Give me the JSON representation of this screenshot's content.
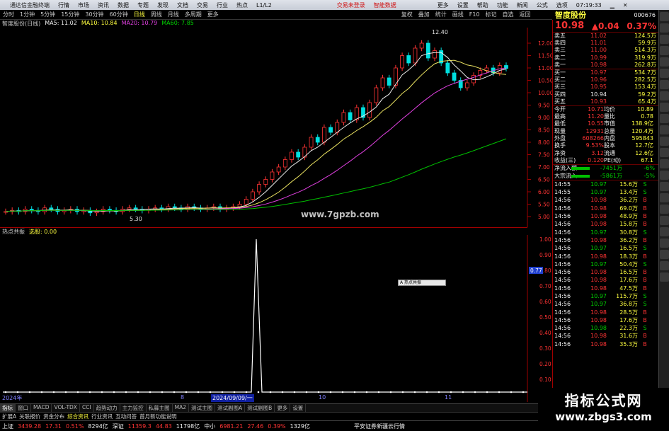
{
  "titlebar": {
    "app": "通达信金融终端",
    "menus": [
      "行情",
      "市场",
      "资讯",
      "数据",
      "专题",
      "发现",
      "文档",
      "交易",
      "行业",
      "热点",
      "L1/L2"
    ],
    "center_links": [
      "交易未登录",
      "智能数据"
    ],
    "right_menus": [
      "更多",
      "设置",
      "帮助",
      "功能",
      "新闻",
      "公式",
      "选项"
    ],
    "time": "07:19:33"
  },
  "toolbar": {
    "periods": [
      "分时",
      "1分钟",
      "5分钟",
      "15分钟",
      "30分钟",
      "60分钟",
      "日线",
      "周线",
      "月线",
      "多周期",
      "更多"
    ],
    "active": "日线",
    "right_tools": [
      "复权",
      "叠加",
      "统计",
      "画线",
      "F10",
      "标记",
      "自选",
      "返回"
    ]
  },
  "stock": {
    "name": "智度股份",
    "code": "000676",
    "price": "10.98",
    "change": "▲0.04",
    "pct": "0.37%"
  },
  "ma_line": {
    "title": "智度股份(日线)",
    "ma5": "MA5: 11.02",
    "ma10": "MA10: 10.84",
    "ma20": "MA20: 10.79",
    "ma60": "MA60: 7.85"
  },
  "price_axis": [
    "12.00",
    "11.50",
    "11.00",
    "10.50",
    "10.00",
    "9.50",
    "9.00",
    "8.50",
    "8.00",
    "7.50",
    "7.00",
    "6.50",
    "6.00",
    "5.50",
    "5.00"
  ],
  "annotations": {
    "high": "12.40",
    "low": "5.30",
    "watermark": "www.7gpzb.com"
  },
  "sub": {
    "title": "热点共振",
    "value": "选股: 0.00",
    "axis": [
      "1.00",
      "0.90",
      "0.80",
      "0.70",
      "0.60",
      "0.50",
      "0.40",
      "0.30",
      "0.20",
      "0.10"
    ],
    "cursor_value": "0.77",
    "popup": "A 热点共振"
  },
  "dates": {
    "left": "2024年",
    "d1": "8",
    "d2": "2024/09/09/一",
    "d3": "10",
    "d4": "11"
  },
  "asks": [
    {
      "l": "卖五",
      "p": "11.02",
      "v": "124.5万"
    },
    {
      "l": "卖四",
      "p": "11.01",
      "v": "59.9万"
    },
    {
      "l": "卖三",
      "p": "11.00",
      "v": "514.3万"
    },
    {
      "l": "卖二",
      "p": "10.99",
      "v": "319.9万"
    },
    {
      "l": "卖一",
      "p": "10.98",
      "v": "262.8万"
    }
  ],
  "bids": [
    {
      "l": "买一",
      "p": "10.97",
      "v": "534.7万"
    },
    {
      "l": "买二",
      "p": "10.96",
      "v": "282.5万"
    },
    {
      "l": "买三",
      "p": "10.95",
      "v": "153.4万"
    },
    {
      "l": "买四",
      "p": "10.94",
      "v": "59.2万"
    },
    {
      "l": "买五",
      "p": "10.93",
      "v": "65.4万"
    }
  ],
  "stats": [
    {
      "a": "今开",
      "b": "10.71",
      "c": "均价",
      "d": "10.89"
    },
    {
      "a": "最高",
      "b": "11.20",
      "c": "量比",
      "d": "0.78"
    },
    {
      "a": "最低",
      "b": "10.55",
      "c": "市值",
      "d": "138.9亿"
    },
    {
      "a": "现量",
      "b": "12931",
      "c": "总量",
      "d": "120.4万"
    },
    {
      "a": "外盘",
      "b": "608266",
      "c": "内盘",
      "d": "595843"
    },
    {
      "a": "换手",
      "b": "9.53%",
      "c": "股本",
      "d": "12.7亿"
    },
    {
      "a": "净资",
      "b": "3.12",
      "c": "流通",
      "d": "12.6亿"
    },
    {
      "a": "收益(三)",
      "b": "0.120",
      "c": "PE(动)",
      "d": "67.1"
    }
  ],
  "flows": [
    {
      "a": "净流入额",
      "b": "-7451万",
      "d": "-6%"
    },
    {
      "a": "大宗流入",
      "b": "-5861万",
      "d": "-5%"
    }
  ],
  "ticks": [
    {
      "t": "14:55",
      "p": "10.97",
      "v": "15.6万",
      "f": "S"
    },
    {
      "t": "14:55",
      "p": "10.97",
      "v": "13.4万",
      "f": "S"
    },
    {
      "t": "14:56",
      "p": "10.98",
      "v": "36.2万",
      "f": "B"
    },
    {
      "t": "14:56",
      "p": "10.98",
      "v": "69.0万",
      "f": "B"
    },
    {
      "t": "14:56",
      "p": "10.98",
      "v": "48.9万",
      "f": "B"
    },
    {
      "t": "14:56",
      "p": "10.98",
      "v": "15.8万",
      "f": "B"
    },
    {
      "t": "14:56",
      "p": "10.97",
      "v": "30.8万",
      "f": "S"
    },
    {
      "t": "14:56",
      "p": "10.98",
      "v": "36.2万",
      "f": "B"
    },
    {
      "t": "14:56",
      "p": "10.97",
      "v": "16.5万",
      "f": "S"
    },
    {
      "t": "14:56",
      "p": "10.98",
      "v": "18.3万",
      "f": "B"
    },
    {
      "t": "14:56",
      "p": "10.97",
      "v": "50.4万",
      "f": "S"
    },
    {
      "t": "14:56",
      "p": "10.98",
      "v": "16.5万",
      "f": "B"
    },
    {
      "t": "14:56",
      "p": "10.98",
      "v": "17.6万",
      "f": "B"
    },
    {
      "t": "14:56",
      "p": "10.98",
      "v": "47.5万",
      "f": "B"
    },
    {
      "t": "14:56",
      "p": "10.97",
      "v": "115.7万",
      "f": "S"
    },
    {
      "t": "14:56",
      "p": "10.97",
      "v": "36.8万",
      "f": "S"
    },
    {
      "t": "14:56",
      "p": "10.98",
      "v": "28.5万",
      "f": "B"
    },
    {
      "t": "14:56",
      "p": "10.98",
      "v": "17.6万",
      "f": "B"
    },
    {
      "t": "14:56",
      "p": "10.98",
      "v": "22.3万",
      "f": "S"
    },
    {
      "t": "14:56",
      "p": "10.98",
      "v": "31.6万",
      "f": "B"
    },
    {
      "t": "14:56",
      "p": "10.98",
      "v": "35.3万",
      "f": "B"
    }
  ],
  "tabs": [
    "指标",
    "窗口",
    "MACD",
    "VOL-TDX",
    "CCI",
    "趋势动力",
    "主力监控",
    "私募主图",
    "MA2",
    "测试主图",
    "测试副图A",
    "测试副图B",
    "更多",
    "设置"
  ],
  "info": [
    "扩展A",
    "关联报价",
    "资金分布",
    "综合资讯",
    "行业资讯",
    "互动问答",
    "首月新功能说明"
  ],
  "status": {
    "sh": "上证",
    "sh_val": "3439.28",
    "sh_chg": "17.31",
    "sh_pct": "0.51%",
    "sh_amt": "8294亿",
    "sz": "深证",
    "sz_val": "11359.3",
    "sz_chg": "44.83",
    "sz_amt": "11798亿",
    "zx": "中小",
    "zx_val": "6981.21",
    "zx_chg": "27.46",
    "zx_pct": "0.39%",
    "zx_amt": "1329亿",
    "right": "平安证券新疆云行情"
  },
  "brand": {
    "title": "指标公式网",
    "url": "www.zbgs3.com"
  },
  "colors": {
    "up": "#ff3434",
    "down": "#00e0e0",
    "ma5": "#e8e8e8",
    "ma10": "#e8e060",
    "ma20": "#e040e0",
    "ma60": "#00c000"
  }
}
